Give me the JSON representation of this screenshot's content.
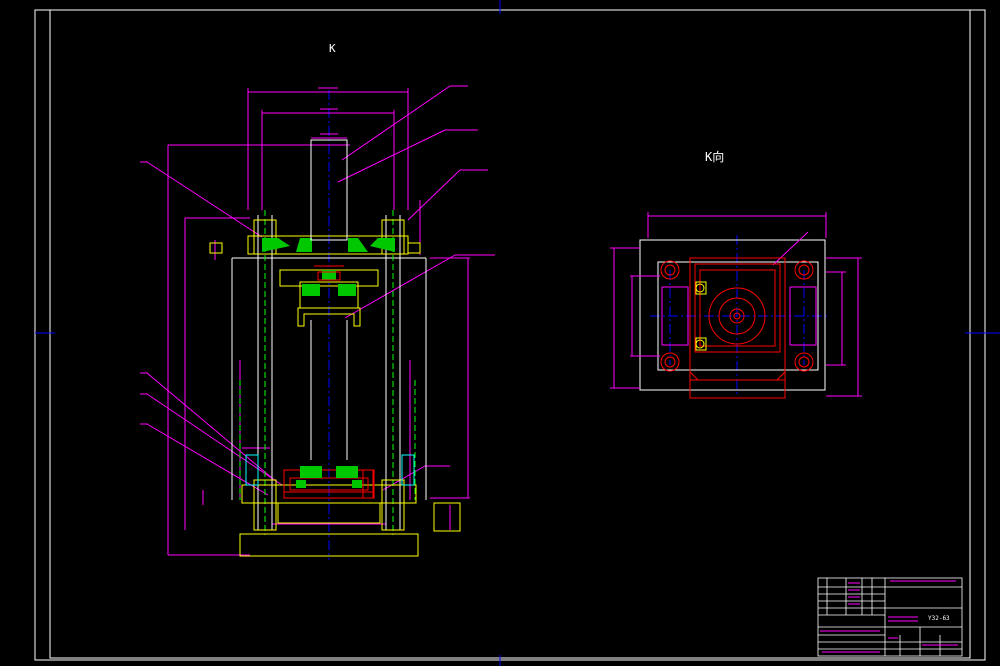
{
  "drawing": {
    "view_label_a": "K",
    "view_label_b": "K向",
    "title_block": {
      "model": "Y32-63"
    },
    "colors": {
      "background": "#000000",
      "frame": "#ffffff",
      "centerline": "#0000ff",
      "dimension": "#ff00ff",
      "outline_primary": "#ffff00",
      "outline_secondary": "#00ffff",
      "section_red": "#ff0000",
      "hatch_green": "#00c800"
    }
  }
}
